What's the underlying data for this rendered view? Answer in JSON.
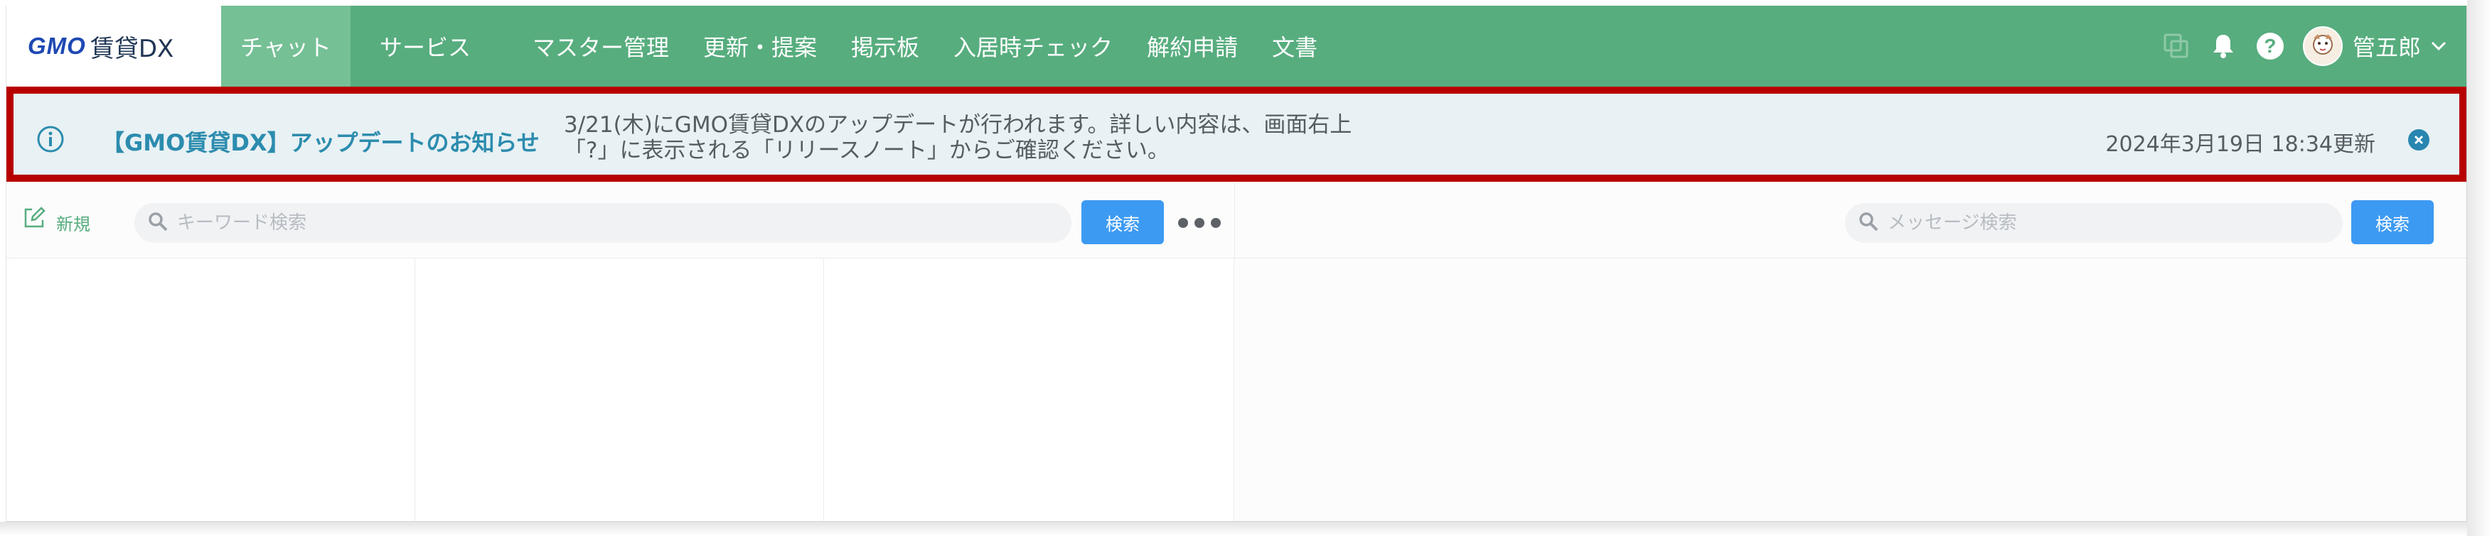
{
  "header": {
    "logo_main": "GMO",
    "logo_sub": "賃貸DX",
    "tabs": [
      {
        "label": "チャット",
        "active": true
      },
      {
        "label": "サービス",
        "active": false
      }
    ],
    "nav": [
      {
        "label": "マスター管理"
      },
      {
        "label": "更新・提案"
      },
      {
        "label": "掲示板"
      },
      {
        "label": "入居時チェック"
      },
      {
        "label": "解約申請"
      },
      {
        "label": "文書"
      }
    ],
    "username": "管五郎",
    "icons": [
      "copy-icon",
      "bell-icon",
      "help-icon",
      "chevron-down-icon"
    ],
    "help_glyph": "?"
  },
  "notice": {
    "title": "【GMO賃貸DX】アップデートのお知らせ",
    "body_line1": "3/21(木)にGMO賃貸DXのアップデートが行われます。詳しい内容は、画面右上",
    "body_line2": "「?」に表示される「リリースノート」からご確認ください。",
    "date": "2024年3月19日 18:34更新",
    "icons": [
      "info-icon",
      "close-icon"
    ]
  },
  "toolbar": {
    "new_label": "新規",
    "search_placeholder": "キーワード検索",
    "search_button": "検索",
    "message_search_placeholder": "メッセージ検索",
    "message_search_button": "検索",
    "icons": [
      "edit-icon",
      "search-icon",
      "more-icon"
    ]
  },
  "colors": {
    "header_green": "#57ad7e",
    "active_tab": "#76c096",
    "notice_bg": "#e8f1f4",
    "notice_title": "#2c8cae",
    "highlight_border": "#b70000",
    "button_blue": "#3d9af2"
  }
}
